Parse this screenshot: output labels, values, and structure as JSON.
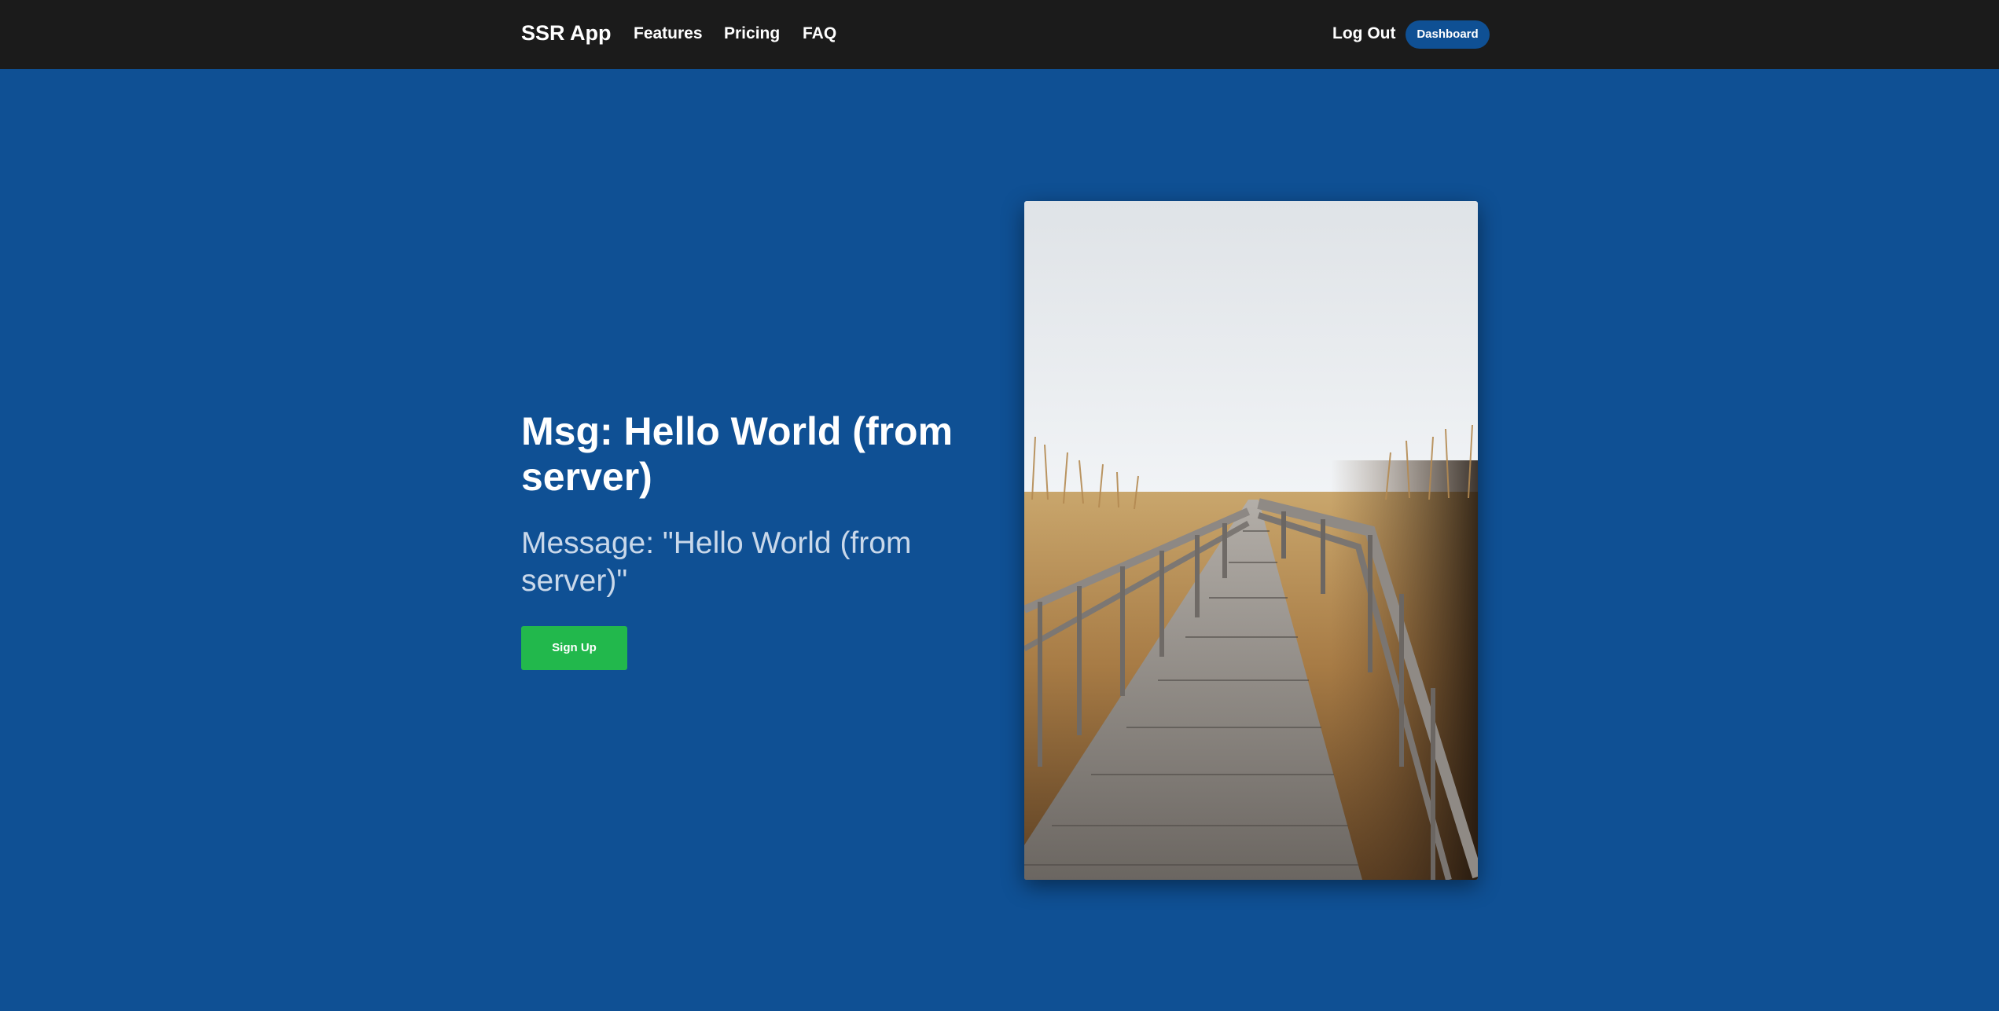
{
  "navbar": {
    "brand": "SSR App",
    "links": [
      "Features",
      "Pricing",
      "FAQ"
    ],
    "logout_label": "Log Out",
    "dashboard_label": "Dashboard"
  },
  "hero": {
    "title": "Msg: Hello World (from server)",
    "subtitle": "Message: \"Hello World (from server)\"",
    "signup_label": "Sign Up",
    "image": "wooden-boardwalk-photo"
  },
  "colors": {
    "navbar_bg": "#1b1b1b",
    "page_bg": "#0f5094",
    "dashboard_button": "#0f5094",
    "signup_button": "#22b84c"
  }
}
